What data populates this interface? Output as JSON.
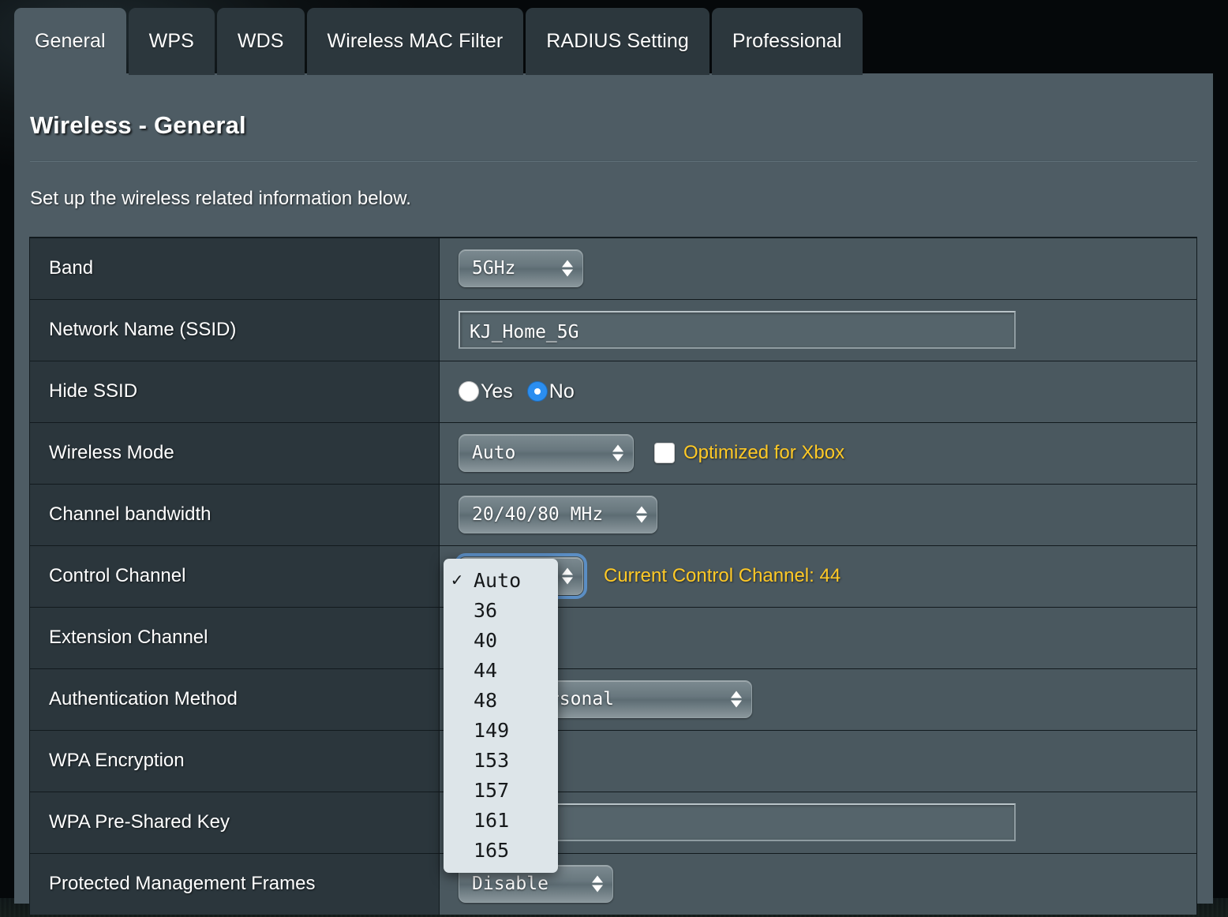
{
  "tabs": [
    {
      "label": "General",
      "active": true
    },
    {
      "label": "WPS",
      "active": false
    },
    {
      "label": "WDS",
      "active": false
    },
    {
      "label": "Wireless MAC Filter",
      "active": false
    },
    {
      "label": "RADIUS Setting",
      "active": false
    },
    {
      "label": "Professional",
      "active": false
    }
  ],
  "page": {
    "title": "Wireless - General",
    "subtitle": "Set up the wireless related information below."
  },
  "rows": {
    "band": {
      "label": "Band",
      "value": "5GHz"
    },
    "ssid": {
      "label": "Network Name (SSID)",
      "value": "KJ_Home_5G"
    },
    "hide_ssid": {
      "label": "Hide SSID",
      "yes": "Yes",
      "no": "No",
      "selected": "No"
    },
    "wireless_mode": {
      "label": "Wireless Mode",
      "value": "Auto",
      "xbox_label": "Optimized for Xbox",
      "xbox_checked": false
    },
    "channel_bandwidth": {
      "label": "Channel bandwidth",
      "value": "20/40/80 MHz"
    },
    "control_channel": {
      "label": "Control Channel",
      "value": "Auto",
      "hint": "Current Control Channel: 44"
    },
    "extension_channel": {
      "label": "Extension Channel",
      "value": ""
    },
    "auth_method": {
      "label": "Authentication Method",
      "value": "WPA2-Personal"
    },
    "wpa_encryption": {
      "label": "WPA Encryption",
      "value": ""
    },
    "wpa_psk": {
      "label": "WPA Pre-Shared Key",
      "value": ""
    },
    "pmf": {
      "label": "Protected Management Frames",
      "value": "Disable"
    }
  },
  "dropdown": {
    "open": true,
    "selected": "Auto",
    "check_glyph": "✓",
    "options": [
      "Auto",
      "36",
      "40",
      "44",
      "48",
      "149",
      "153",
      "157",
      "161",
      "165"
    ]
  },
  "colors": {
    "accent_yellow": "#ffc926",
    "radio_blue": "#2b8ef0",
    "panel_bg": "#4e5c64",
    "label_cell_bg": "#2b363c",
    "value_cell_bg": "#4a585f"
  }
}
